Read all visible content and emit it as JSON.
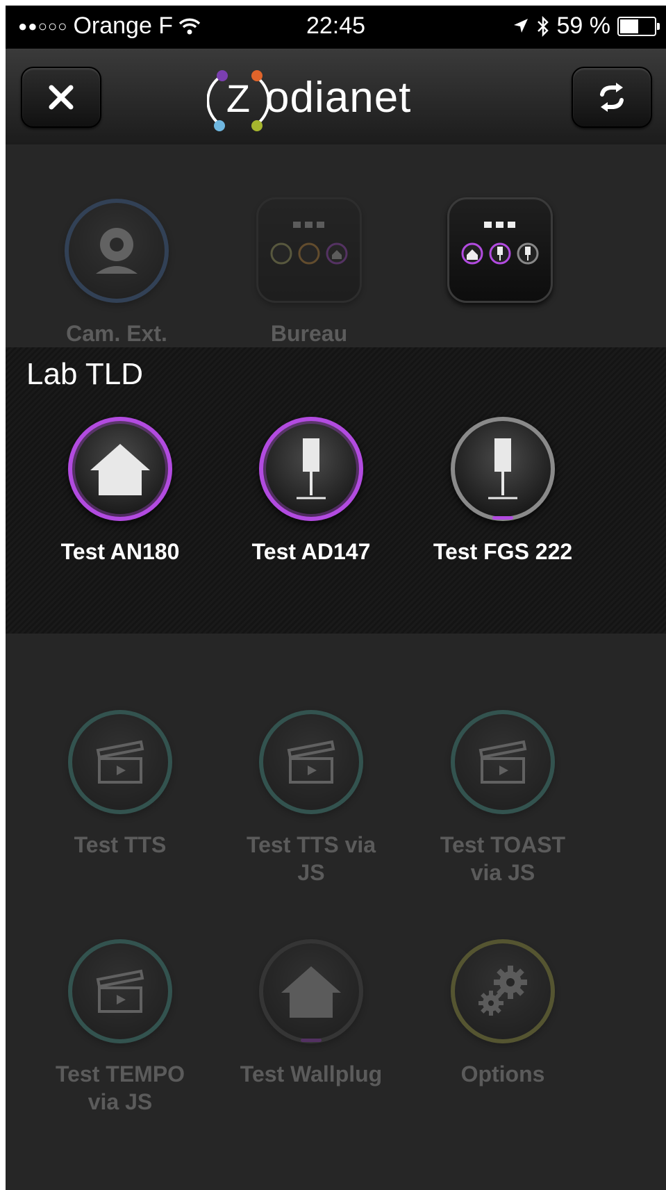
{
  "status_bar": {
    "carrier": "Orange F",
    "signal_dots": "●●○○○",
    "time": "22:45",
    "battery": "59 %",
    "battery_level": 0.59
  },
  "header": {
    "logo_letter": "Z",
    "logo_text": "odianet",
    "close_icon": "close-icon",
    "refresh_icon": "refresh-icon"
  },
  "top_row": [
    {
      "label": "Cam. Ext.",
      "icon": "webcam-icon"
    },
    {
      "label": "Bureau",
      "icon": "room-group-icon"
    },
    {
      "label": "",
      "icon": "room-group-icon"
    }
  ],
  "lab_section": {
    "title": "Lab TLD",
    "items": [
      {
        "label": "Test AN180",
        "icon": "house-icon"
      },
      {
        "label": "Test AD147",
        "icon": "lamp-icon"
      },
      {
        "label": "Test FGS 222",
        "icon": "lamp-icon"
      }
    ]
  },
  "scenarios": [
    {
      "label": "Test TTS",
      "icon": "clapperboard-icon"
    },
    {
      "label": "Test TTS via JS",
      "icon": "clapperboard-icon"
    },
    {
      "label": "Test TOAST via JS",
      "icon": "clapperboard-icon"
    },
    {
      "label": "Test TEMPO via JS",
      "icon": "clapperboard-icon"
    },
    {
      "label": "Test Wallplug",
      "icon": "house-icon"
    },
    {
      "label": "Options",
      "icon": "gears-icon"
    }
  ],
  "colors": {
    "purple_accent": "#b24be0",
    "teal_ring": "#4fb3a7",
    "blue_ring": "#4a78b8",
    "olive_ring": "#b8b84a"
  }
}
